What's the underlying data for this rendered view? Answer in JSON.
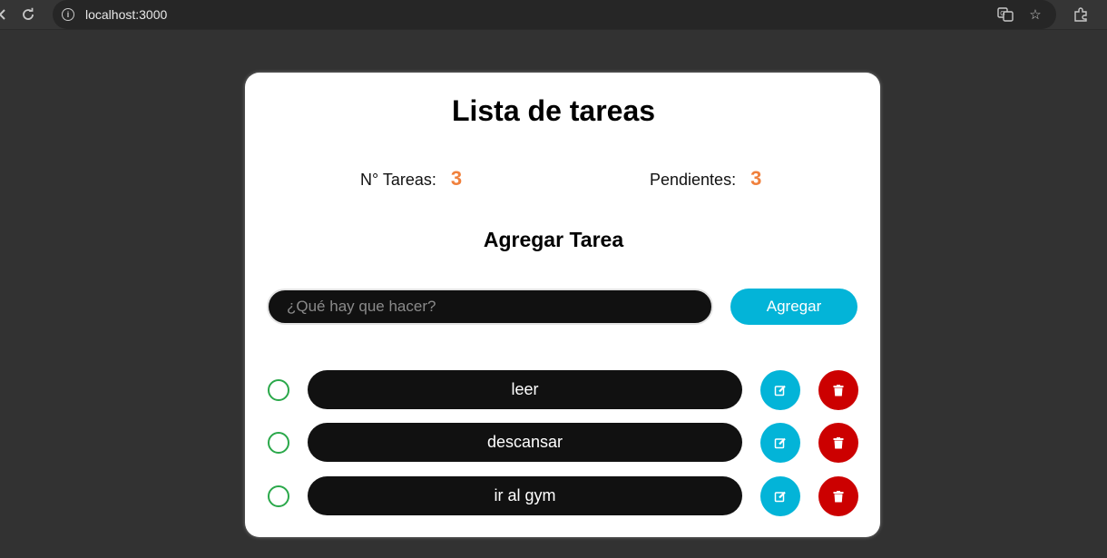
{
  "browser": {
    "url": "localhost:3000"
  },
  "app": {
    "title": "Lista de tareas",
    "stats": {
      "total_label": "N° Tareas:",
      "total_value": "3",
      "pending_label": "Pendientes:",
      "pending_value": "3"
    },
    "add_section": {
      "title": "Agregar Tarea",
      "input_placeholder": "¿Qué hay que hacer?",
      "input_value": "",
      "button_label": "Agregar"
    },
    "tasks": [
      {
        "text": "leer",
        "completed": false
      },
      {
        "text": "descansar",
        "completed": false
      },
      {
        "text": "ir al gym",
        "completed": false
      }
    ]
  },
  "colors": {
    "accent": "#03b4d8",
    "danger": "#cc0000",
    "counter": "#f0803c",
    "check": "#2aa84a"
  }
}
